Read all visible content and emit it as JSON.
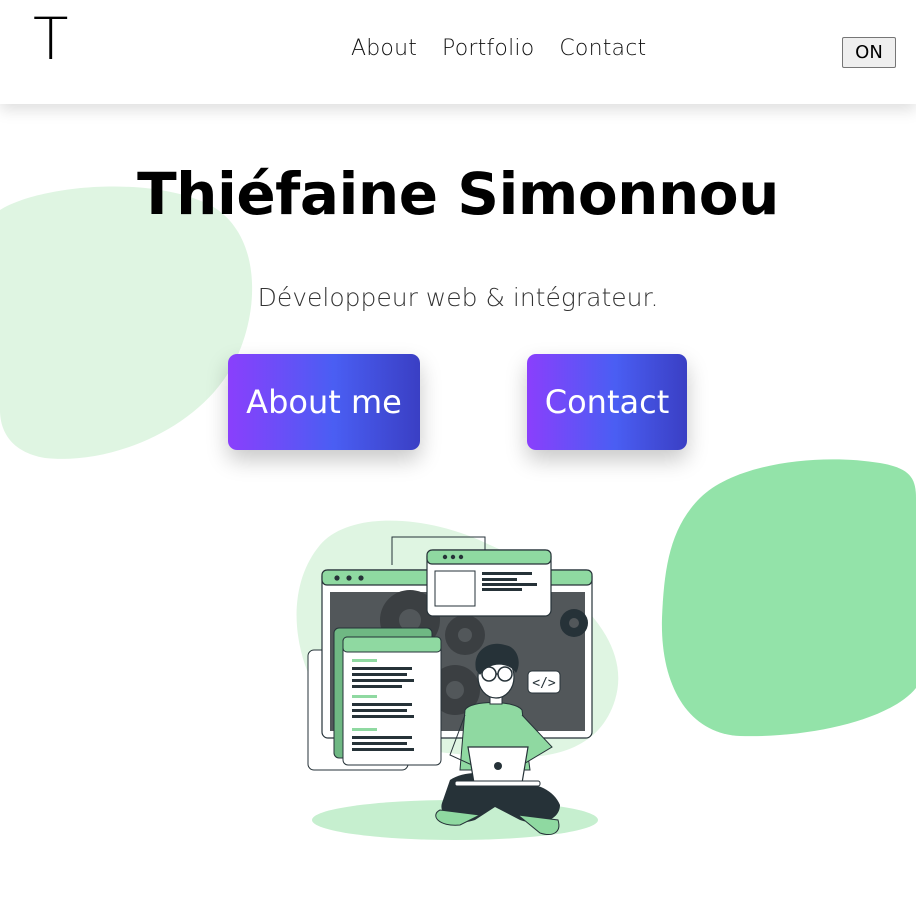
{
  "header": {
    "logo": "T",
    "nav": [
      "About",
      "Portfolio",
      "Contact"
    ],
    "toggle": "ON"
  },
  "hero": {
    "name": "Thiéfaine Simonnou",
    "tagline": "Développeur web & intégrateur.",
    "buttons": {
      "about": "About me",
      "contact": "Contact"
    }
  },
  "illustration": {
    "code_tag": "</>"
  },
  "colors": {
    "blob_light": "#dff5e2",
    "blob_green": "#93e3a9",
    "button_start": "#8a3ffc",
    "button_end": "#3a3fc4",
    "accent_green": "#8fd9a1"
  }
}
